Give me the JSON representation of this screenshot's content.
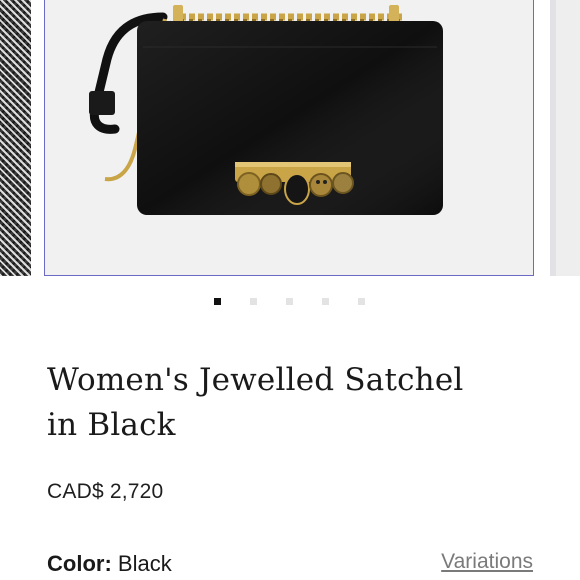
{
  "product": {
    "title_line1": "Women's Jewelled Satchel",
    "title_line2": "in Black",
    "price": "CAD$ 2,720",
    "color_label": "Color:",
    "color_value": "Black",
    "variations_label": "Variations"
  },
  "carousel": {
    "slide_count": 5,
    "active_index": 0
  },
  "colors": {
    "bag": "#0f0f0f",
    "hardware_gold": "#c9a548",
    "active_dot": "#111111",
    "inactive_dot": "#e3e3e3",
    "slide_border": "#6b6bc6"
  },
  "icons": [
    "skull-ring-icon"
  ]
}
